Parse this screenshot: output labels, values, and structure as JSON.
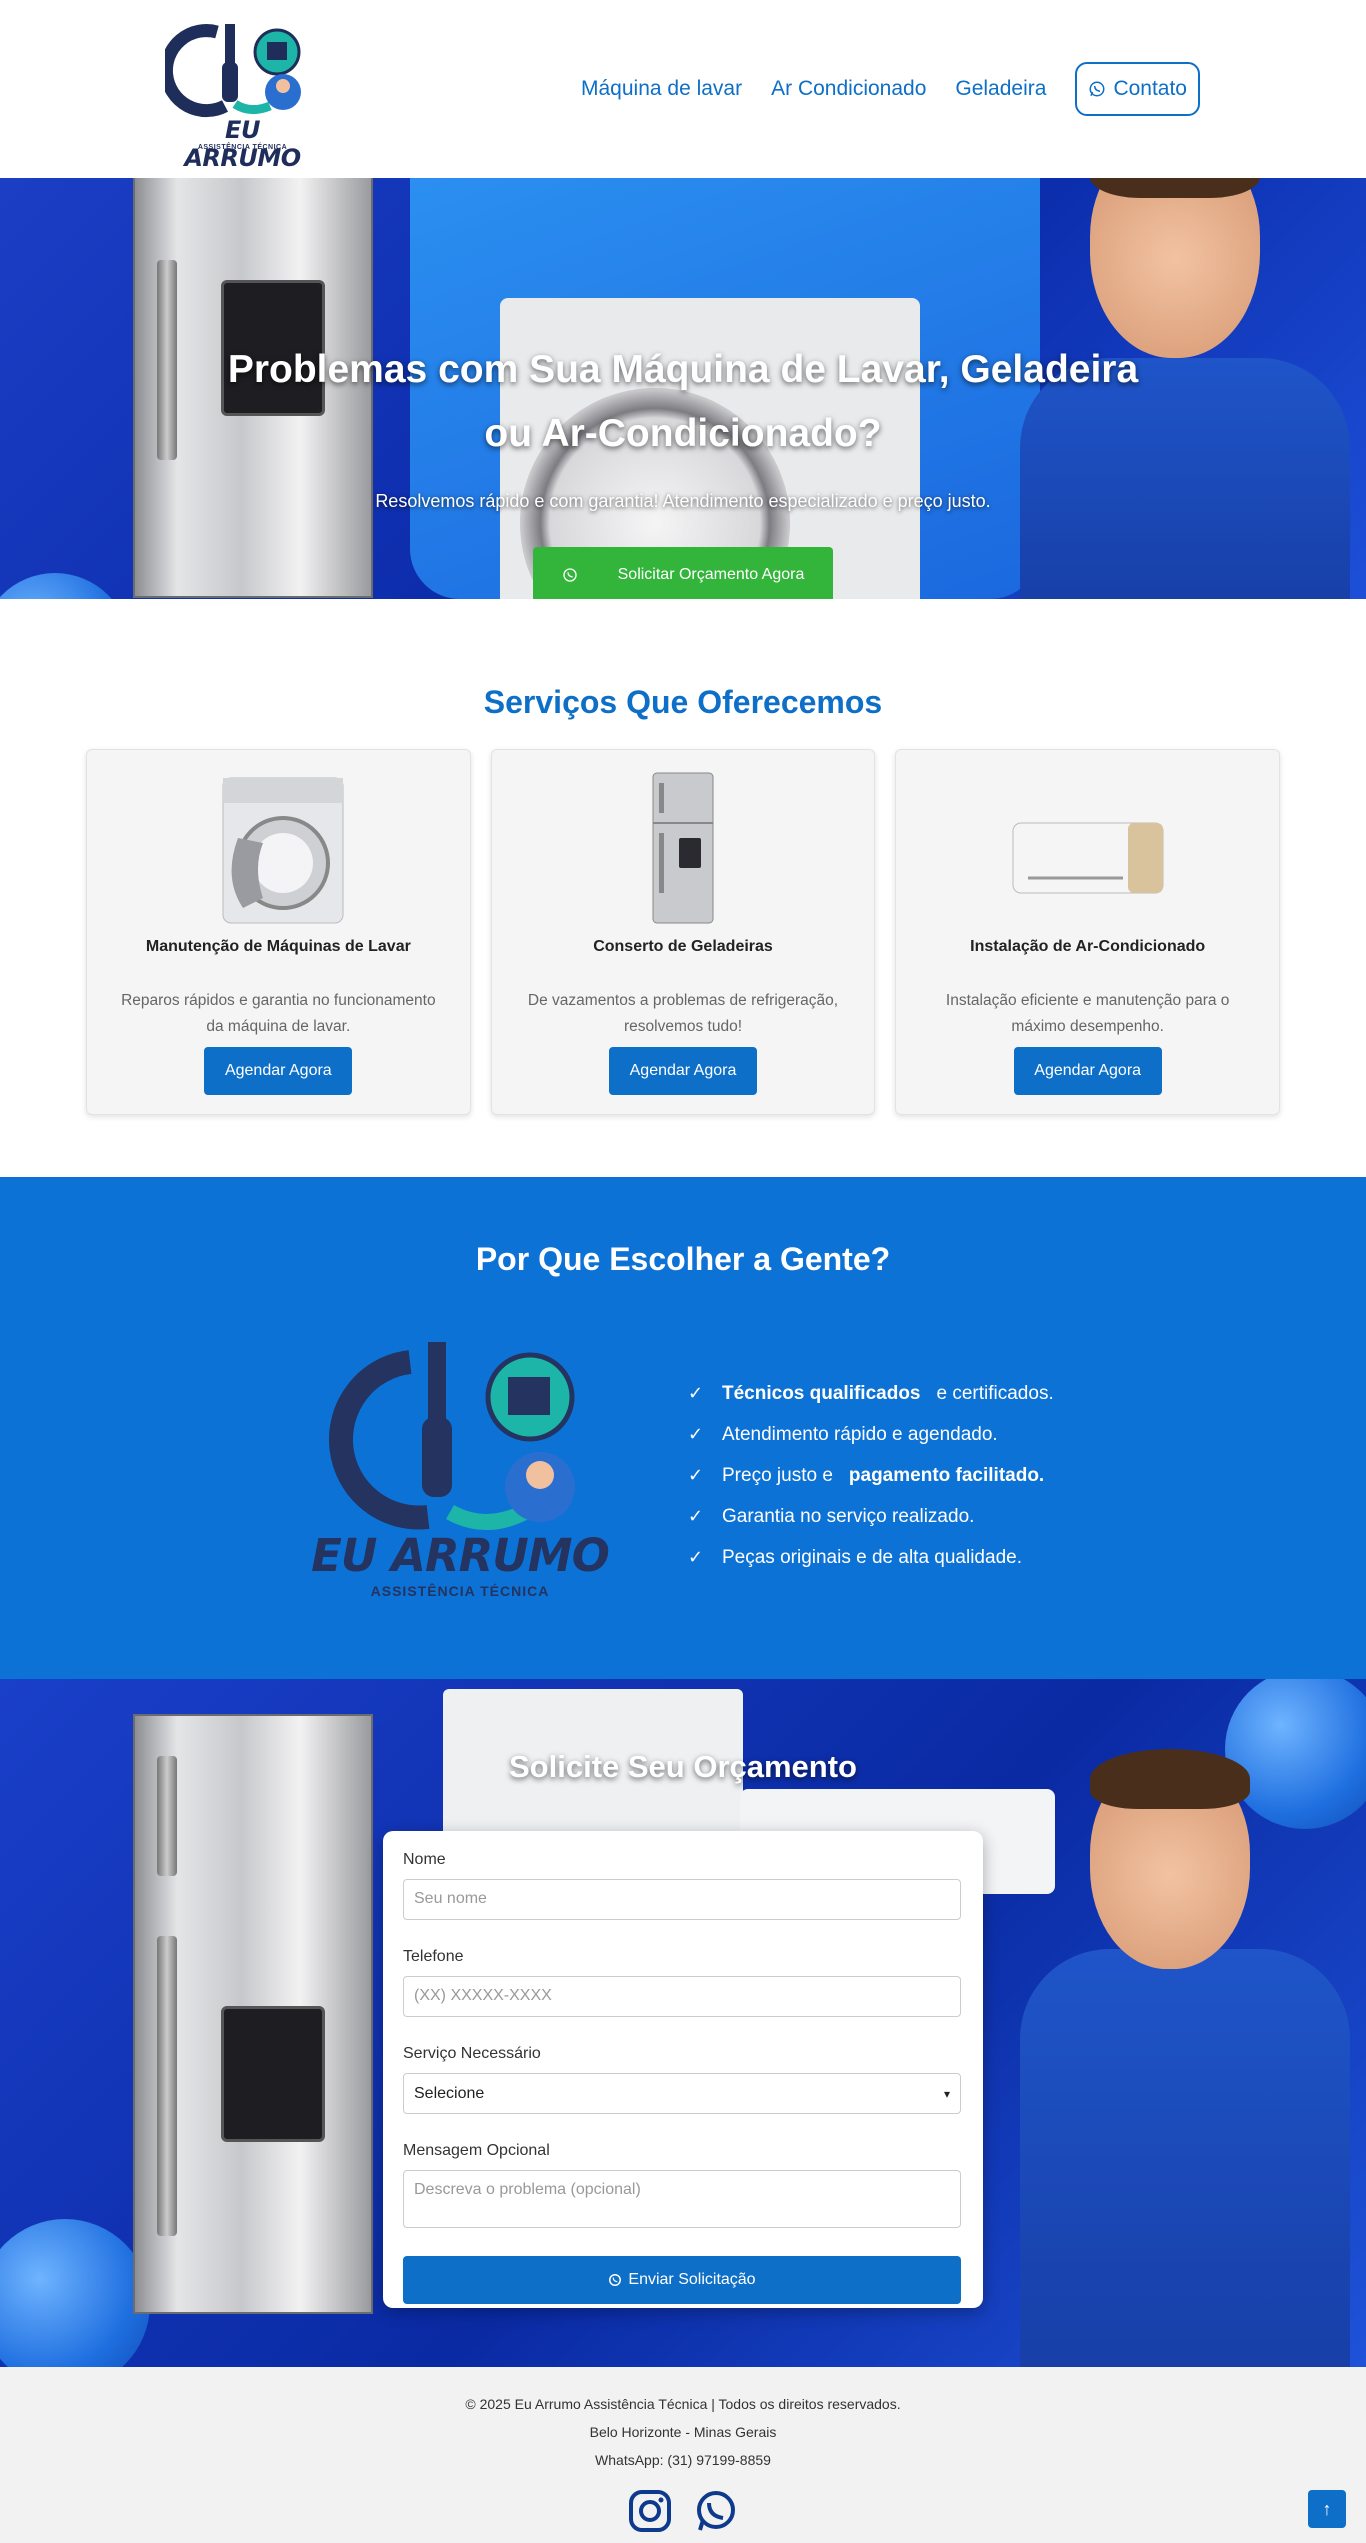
{
  "header": {
    "logo_brand": "EU ARRUMO",
    "logo_tag": "ASSISTÊNCIA TÉCNICA",
    "nav": [
      "Máquina de lavar",
      "Ar Condicionado",
      "Geladeira"
    ],
    "contact_label": "Contato"
  },
  "hero": {
    "title_line1": "Problemas com Sua Máquina de Lavar, Geladeira",
    "title_line2": "ou Ar-Condicionado?",
    "subtitle": "Resolvemos rápido e com garantia! Atendimento especializado e preço justo.",
    "cta_label": "Solicitar Orçamento Agora"
  },
  "services": {
    "title": "Serviços Que Oferecemos",
    "cards": [
      {
        "title": "Manutenção de Máquinas de Lavar",
        "text": "Reparos rápidos e garantia no funcionamento da máquina de lavar.",
        "button": "Agendar Agora"
      },
      {
        "title": "Conserto de Geladeiras",
        "text": "De vazamentos a problemas de refrigeração, resolvemos tudo!",
        "button": "Agendar Agora"
      },
      {
        "title": "Instalação de Ar-Condicionado",
        "text": "Instalação eficiente e manutenção para o máximo desempenho.",
        "button": "Agendar Agora"
      }
    ]
  },
  "why": {
    "title": "Por Que Escolher a Gente?",
    "logo_brand": "EU ARRUMO",
    "logo_tag": "ASSISTÊNCIA TÉCNICA",
    "items": [
      {
        "bold": "Técnicos qualificados",
        "text": "e certificados."
      },
      {
        "bold": "",
        "text": "Atendimento rápido e agendado."
      },
      {
        "bold": "",
        "text": "Preço justo e",
        "bold_after": "pagamento facilitado."
      },
      {
        "bold": "",
        "text": "Garantia no serviço realizado."
      },
      {
        "bold": "",
        "text": "Peças originais e de alta qualidade."
      }
    ]
  },
  "quote": {
    "title": "Solicite Seu Orçamento",
    "name_label": "Nome",
    "name_placeholder": "Seu nome",
    "phone_label": "Telefone",
    "phone_placeholder": "(XX) XXXXX-XXXX",
    "service_label": "Serviço Necessário",
    "service_selected": "Selecione",
    "message_label": "Mensagem Opcional",
    "message_placeholder": "Descreva o problema (opcional)",
    "submit_label": "Enviar Solicitação"
  },
  "footer": {
    "copyright": "© 2025 Eu Arrumo Assistência Técnica | Todos os direitos reservados.",
    "location": "Belo Horizonte - Minas Gerais",
    "whatsapp": "WhatsApp: (31) 97199-8859",
    "to_top": "↑"
  },
  "colors": {
    "primary": "#0d6fc7",
    "cta_green": "#33b53c",
    "why_bg": "#0d72d6",
    "hero_bg": "#0a2aa8"
  }
}
